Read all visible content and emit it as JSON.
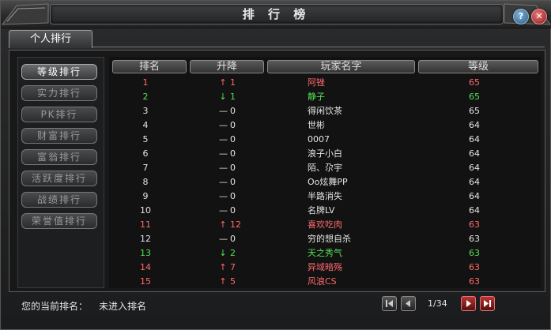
{
  "window": {
    "title": "排 行 榜"
  },
  "title_buttons": {
    "help": "?",
    "close": "✕"
  },
  "tab": {
    "label": "个人排行"
  },
  "sidebar": {
    "items": [
      {
        "label": "等级排行",
        "active": true
      },
      {
        "label": "实力排行",
        "active": false
      },
      {
        "label": "PK排行",
        "active": false
      },
      {
        "label": "财富排行",
        "active": false
      },
      {
        "label": "富翁排行",
        "active": false
      },
      {
        "label": "活跃度排行",
        "active": false
      },
      {
        "label": "战绩排行",
        "active": false
      },
      {
        "label": "荣誉值排行",
        "active": false
      }
    ]
  },
  "table": {
    "headers": [
      "排名",
      "升降",
      "玩家名字",
      "等级"
    ],
    "rows": [
      {
        "rank": "1",
        "arrow": "↑",
        "change": "1",
        "name": "阿锉",
        "level": "65",
        "color": "red"
      },
      {
        "rank": "2",
        "arrow": "↓",
        "change": "1",
        "name": "静子",
        "level": "65",
        "color": "green"
      },
      {
        "rank": "3",
        "arrow": "—",
        "change": "0",
        "name": "得闲饮茶",
        "level": "65",
        "color": "white"
      },
      {
        "rank": "4",
        "arrow": "—",
        "change": "0",
        "name": "世彬",
        "level": "64",
        "color": "white"
      },
      {
        "rank": "5",
        "arrow": "—",
        "change": "0",
        "name": "0007",
        "level": "64",
        "color": "white"
      },
      {
        "rank": "6",
        "arrow": "—",
        "change": "0",
        "name": "浪子小白",
        "level": "64",
        "color": "white"
      },
      {
        "rank": "7",
        "arrow": "—",
        "change": "0",
        "name": "陌、尕宇",
        "level": "64",
        "color": "white"
      },
      {
        "rank": "8",
        "arrow": "—",
        "change": "0",
        "name": "Oo炫舞PP",
        "level": "64",
        "color": "white"
      },
      {
        "rank": "9",
        "arrow": "—",
        "change": "0",
        "name": "半路消失",
        "level": "64",
        "color": "white"
      },
      {
        "rank": "10",
        "arrow": "—",
        "change": "0",
        "name": "名牌LV",
        "level": "64",
        "color": "white"
      },
      {
        "rank": "11",
        "arrow": "↑",
        "change": "12",
        "name": "喜欢吃肉",
        "level": "63",
        "color": "red"
      },
      {
        "rank": "12",
        "arrow": "—",
        "change": "0",
        "name": "穷的想自杀",
        "level": "63",
        "color": "white"
      },
      {
        "rank": "13",
        "arrow": "↓",
        "change": "2",
        "name": "天之秀气",
        "level": "63",
        "color": "green"
      },
      {
        "rank": "14",
        "arrow": "↑",
        "change": "7",
        "name": "异域暗殇",
        "level": "63",
        "color": "red"
      },
      {
        "rank": "15",
        "arrow": "↑",
        "change": "5",
        "name": "风浪CS",
        "level": "63",
        "color": "red"
      }
    ]
  },
  "footer": {
    "rank_label": "您的当前排名：",
    "rank_value": "未进入排名",
    "page": "1/34"
  },
  "colors": {
    "up": "#ff6a6a",
    "down": "#54e054",
    "neutral": "#e4e4e4"
  }
}
